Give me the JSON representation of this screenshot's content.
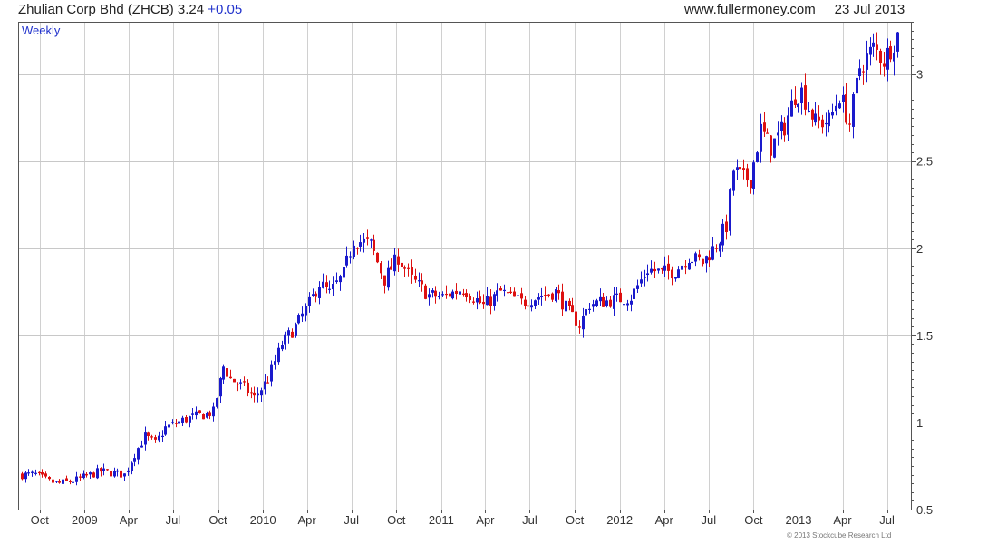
{
  "header": {
    "title": "Zhulian Corp Bhd (ZHCB)",
    "price": "3.24",
    "change": "+0.05",
    "site": "www.fullermoney.com",
    "date": "23 Jul 2013"
  },
  "footer": {
    "copyright": "© 2013 Stockcube Research Ltd"
  },
  "colors": {
    "up": "#1a1acc",
    "down": "#dd1111",
    "grid": "#d0d0d0",
    "frame": "#555555",
    "label": "#2233cc"
  },
  "chart_data": {
    "type": "candlestick",
    "period_label": "Weekly",
    "title": "Zhulian Corp Bhd (ZHCB)",
    "xlabel": "",
    "ylabel": "",
    "ylim": [
      0.5,
      3.3
    ],
    "y_ticks": [
      0.5,
      1,
      1.5,
      2,
      2.5,
      3
    ],
    "y_tick_labels": [
      "0.5",
      "1",
      "1.5",
      "2",
      "2.5",
      "3"
    ],
    "x_range": [
      "2008-08-18",
      "2013-08-19"
    ],
    "x_ticks": [
      {
        "date": "2008-10-01",
        "label": "Oct"
      },
      {
        "date": "2009-01-01",
        "label": "2009"
      },
      {
        "date": "2009-04-01",
        "label": "Apr"
      },
      {
        "date": "2009-07-01",
        "label": "Jul"
      },
      {
        "date": "2009-10-01",
        "label": "Oct"
      },
      {
        "date": "2010-01-01",
        "label": "2010"
      },
      {
        "date": "2010-04-01",
        "label": "Apr"
      },
      {
        "date": "2010-07-01",
        "label": "Jul"
      },
      {
        "date": "2010-10-01",
        "label": "Oct"
      },
      {
        "date": "2011-01-01",
        "label": "2011"
      },
      {
        "date": "2011-04-01",
        "label": "Apr"
      },
      {
        "date": "2011-07-01",
        "label": "Jul"
      },
      {
        "date": "2011-10-01",
        "label": "Oct"
      },
      {
        "date": "2012-01-01",
        "label": "2012"
      },
      {
        "date": "2012-04-01",
        "label": "Apr"
      },
      {
        "date": "2012-07-01",
        "label": "Jul"
      },
      {
        "date": "2012-10-01",
        "label": "Oct"
      },
      {
        "date": "2013-01-01",
        "label": "2013"
      },
      {
        "date": "2013-04-01",
        "label": "Apr"
      },
      {
        "date": "2013-07-01",
        "label": "Jul"
      }
    ],
    "grid": true,
    "price_path": [
      [
        "2008-08-25",
        0.7
      ],
      [
        "2008-09-22",
        0.7
      ],
      [
        "2008-10-20",
        0.66
      ],
      [
        "2008-11-10",
        0.65
      ],
      [
        "2008-12-15",
        0.67
      ],
      [
        "2009-02-02",
        0.72
      ],
      [
        "2009-03-23",
        0.7
      ],
      [
        "2009-04-13",
        0.82
      ],
      [
        "2009-05-04",
        0.92
      ],
      [
        "2009-05-25",
        0.88
      ],
      [
        "2009-06-15",
        0.97
      ],
      [
        "2009-07-27",
        1.02
      ],
      [
        "2009-09-21",
        1.06
      ],
      [
        "2009-10-12",
        1.32
      ],
      [
        "2009-10-26",
        1.25
      ],
      [
        "2009-11-23",
        1.2
      ],
      [
        "2009-12-14",
        1.14
      ],
      [
        "2010-01-11",
        1.25
      ],
      [
        "2010-02-08",
        1.45
      ],
      [
        "2010-03-08",
        1.55
      ],
      [
        "2010-04-05",
        1.68
      ],
      [
        "2010-04-26",
        1.8
      ],
      [
        "2010-05-17",
        1.74
      ],
      [
        "2010-06-14",
        1.85
      ],
      [
        "2010-07-05",
        2.05
      ],
      [
        "2010-08-09",
        2.02
      ],
      [
        "2010-09-06",
        1.82
      ],
      [
        "2010-10-04",
        1.95
      ],
      [
        "2010-11-01",
        1.82
      ],
      [
        "2010-12-06",
        1.73
      ],
      [
        "2011-01-03",
        1.72
      ],
      [
        "2011-02-14",
        1.77
      ],
      [
        "2011-03-28",
        1.67
      ],
      [
        "2011-05-02",
        1.75
      ],
      [
        "2011-06-13",
        1.69
      ],
      [
        "2011-07-25",
        1.73
      ],
      [
        "2011-08-22",
        1.75
      ],
      [
        "2011-09-19",
        1.63
      ],
      [
        "2011-10-10",
        1.56
      ],
      [
        "2011-10-31",
        1.68
      ],
      [
        "2011-12-12",
        1.7
      ],
      [
        "2012-01-23",
        1.72
      ],
      [
        "2012-02-27",
        1.88
      ],
      [
        "2012-03-26",
        1.86
      ],
      [
        "2012-04-23",
        1.87
      ],
      [
        "2012-05-21",
        1.95
      ],
      [
        "2012-06-18",
        1.92
      ],
      [
        "2012-07-16",
        2.02
      ],
      [
        "2012-08-06",
        2.13
      ],
      [
        "2012-08-20",
        2.45
      ],
      [
        "2012-09-10",
        2.4
      ],
      [
        "2012-09-24",
        2.4
      ],
      [
        "2012-10-15",
        2.68
      ],
      [
        "2012-11-05",
        2.58
      ],
      [
        "2012-12-03",
        2.7
      ],
      [
        "2012-12-24",
        2.88
      ],
      [
        "2013-01-07",
        2.9
      ],
      [
        "2013-02-04",
        2.72
      ],
      [
        "2013-03-04",
        2.73
      ],
      [
        "2013-03-25",
        2.88
      ],
      [
        "2013-04-15",
        2.72
      ],
      [
        "2013-05-06",
        3.04
      ],
      [
        "2013-06-03",
        3.15
      ],
      [
        "2013-06-24",
        3.08
      ],
      [
        "2013-07-15",
        3.19
      ],
      [
        "2013-07-22",
        3.24
      ]
    ],
    "last_close": 3.24
  }
}
